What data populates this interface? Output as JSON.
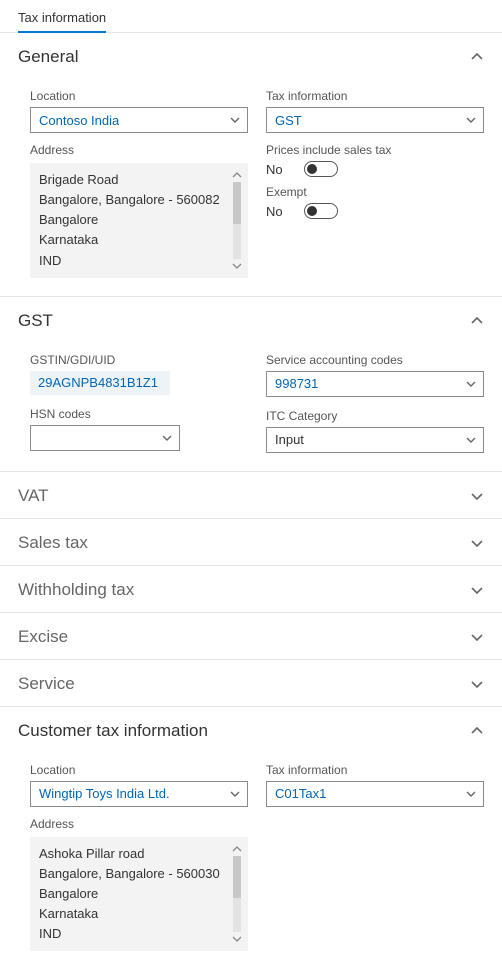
{
  "tab": {
    "label": "Tax information"
  },
  "sections": {
    "general": {
      "title": "General",
      "location_label": "Location",
      "location_value": "Contoso India",
      "address_label": "Address",
      "address_lines": [
        "Brigade Road",
        "Bangalore, Bangalore - 560082",
        "Bangalore",
        "Karnataka",
        "IND"
      ],
      "tax_info_label": "Tax information",
      "tax_info_value": "GST",
      "prices_label": "Prices include sales tax",
      "prices_value": "No",
      "exempt_label": "Exempt",
      "exempt_value": "No"
    },
    "gst": {
      "title": "GST",
      "gstin_label": "GSTIN/GDI/UID",
      "gstin_value": "29AGNPB4831B1Z1",
      "hsn_label": "HSN codes",
      "hsn_value": "",
      "sac_label": "Service accounting codes",
      "sac_value": "998731",
      "itc_label": "ITC Category",
      "itc_value": "Input"
    },
    "vat": {
      "title": "VAT"
    },
    "sales_tax": {
      "title": "Sales tax"
    },
    "withholding": {
      "title": "Withholding tax"
    },
    "excise": {
      "title": "Excise"
    },
    "service": {
      "title": "Service"
    },
    "customer": {
      "title": "Customer tax information",
      "location_label": "Location",
      "location_value": "Wingtip Toys India Ltd.",
      "address_label": "Address",
      "address_lines": [
        "Ashoka Pillar road",
        "Bangalore, Bangalore - 560030",
        "Bangalore",
        "Karnataka",
        "IND"
      ],
      "tax_info_label": "Tax information",
      "tax_info_value": "C01Tax1"
    }
  }
}
